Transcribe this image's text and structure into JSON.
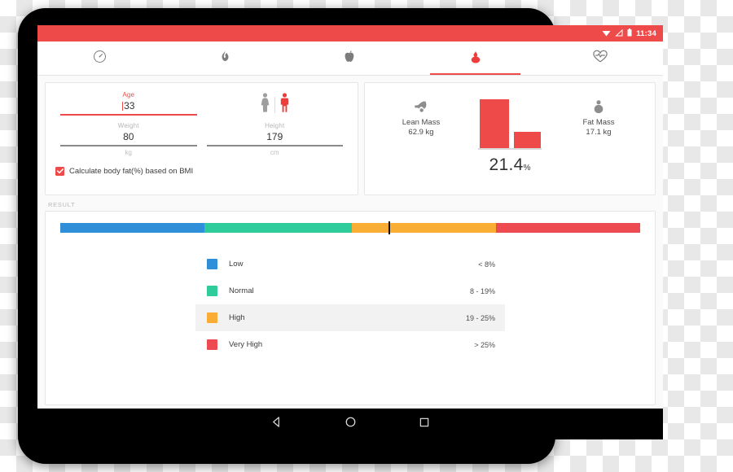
{
  "status_bar": {
    "time": "11:34",
    "icons": [
      "wifi-icon",
      "signal-icon",
      "battery-icon"
    ]
  },
  "tabs": [
    {
      "name": "tab-dashboard",
      "icon": "gauge-icon",
      "active": false
    },
    {
      "name": "tab-calories",
      "icon": "flame-icon",
      "active": false
    },
    {
      "name": "tab-nutrition",
      "icon": "apple-icon",
      "active": false
    },
    {
      "name": "tab-body-fat",
      "icon": "droplet-icon",
      "active": true
    },
    {
      "name": "tab-heart-rate",
      "icon": "heartbeat-icon",
      "active": false
    }
  ],
  "form": {
    "age": {
      "label": "Age",
      "value": "33"
    },
    "gender": {
      "female_icon": "female-figure-icon",
      "male_icon": "male-figure-icon",
      "selected": "male"
    },
    "weight": {
      "label": "Weight",
      "value": "80",
      "unit": "kg"
    },
    "height": {
      "label": "Height",
      "value": "179",
      "unit": "cm"
    },
    "checkbox": {
      "label": "Calculate body fat(%) based on BMI",
      "checked": true
    }
  },
  "summary": {
    "lean": {
      "icon": "muscle-arm-icon",
      "name": "Lean Mass",
      "value": "62.9 kg"
    },
    "fat": {
      "icon": "fat-body-icon",
      "name": "Fat Mass",
      "value": "17.1 kg"
    },
    "percent": "21.4",
    "percent_symbol": "%"
  },
  "result": {
    "section_label": "RESULT"
  },
  "chart_data": {
    "type": "bar",
    "title": "Body composition",
    "categories": [
      "Lean Mass",
      "Fat Mass"
    ],
    "values": [
      62.9,
      17.1
    ],
    "unit": "kg",
    "ylim": [
      0,
      70
    ],
    "annotation": "21.4%",
    "color": "#ee4a4a",
    "scale": {
      "type": "categorical-range-bar",
      "marker_value": 21.4,
      "marker_position_pct": 56.6,
      "segments": [
        {
          "label": "Low",
          "range": "< 8%",
          "color": "#2f8fd8",
          "width_pct": 24.8
        },
        {
          "label": "Normal",
          "range": "8 - 19%",
          "color": "#2ecc9b",
          "width_pct": 25.5
        },
        {
          "label": "High",
          "range": "19 - 25%",
          "color": "#f9ad35",
          "width_pct": 24.9
        },
        {
          "label": "Very High",
          "range": "> 25%",
          "color": "#ee4a51",
          "width_pct": 24.8
        }
      ]
    }
  },
  "legend": [
    {
      "label": "Low",
      "value": "< 8%",
      "color": "#2f8fd8",
      "highlighted": false
    },
    {
      "label": "Normal",
      "value": "8 - 19%",
      "color": "#2ecc9b",
      "highlighted": false
    },
    {
      "label": "High",
      "value": "19 - 25%",
      "color": "#f9ad35",
      "highlighted": true
    },
    {
      "label": "Very High",
      "value": "> 25%",
      "color": "#ee4a51",
      "highlighted": false
    }
  ],
  "navigation": [
    {
      "name": "nav-back-button",
      "icon": "triangle-back-icon"
    },
    {
      "name": "nav-home-button",
      "icon": "circle-home-icon"
    },
    {
      "name": "nav-recents-button",
      "icon": "square-recents-icon"
    }
  ],
  "colors": {
    "accent": "#ef4a4a",
    "screen_bg": "#fafafa"
  }
}
